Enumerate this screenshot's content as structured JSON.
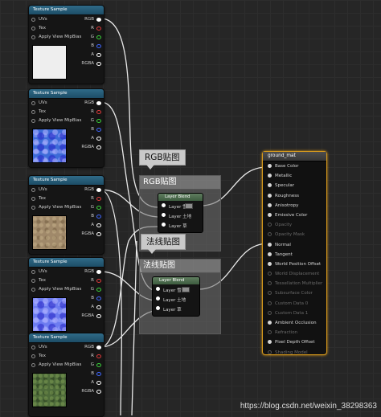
{
  "texture_nodes": [
    {
      "title": "Texture Sample",
      "thumb": "#eeeeee",
      "thumb_style": "white"
    },
    {
      "title": "Texture Sample",
      "thumb": "#3d6bd8",
      "thumb_style": "normal"
    },
    {
      "title": "Texture Sample",
      "thumb": "#a0896a",
      "thumb_style": "sand"
    },
    {
      "title": "Texture Sample",
      "thumb": "#6d7cf0",
      "thumb_style": "normal2"
    },
    {
      "title": "Texture Sample",
      "thumb": "#4e6b3a",
      "thumb_style": "grass"
    }
  ],
  "texture_pins_in": [
    "UVs",
    "Tex",
    "Apply View MipBias"
  ],
  "texture_pins_out": [
    "RGB",
    "R",
    "G",
    "B",
    "A",
    "RGBA"
  ],
  "pin_colors": {
    "rgb": "#ffffff",
    "r": "#e23b3b",
    "g": "#3bd33b",
    "b": "#3f67ff",
    "a": "#ffffff",
    "rgba": "#ffffff"
  },
  "comments": [
    {
      "bubble": "RGB贴图",
      "title": "RGB贴图"
    },
    {
      "bubble": "法线贴图",
      "title": "法线贴图"
    }
  ],
  "blend_nodes": [
    {
      "title": "Layer Blend",
      "rows": [
        "Layer 雪",
        "Layer 土地",
        "Layer 草"
      ]
    },
    {
      "title": "Layer Blend",
      "rows": [
        "Layer 雪",
        "Layer 土地",
        "Layer 草"
      ]
    }
  ],
  "material": {
    "title": "ground_mat",
    "inputs": [
      {
        "label": "Base Color",
        "enabled": true
      },
      {
        "label": "Metallic",
        "enabled": true
      },
      {
        "label": "Specular",
        "enabled": true
      },
      {
        "label": "Roughness",
        "enabled": true
      },
      {
        "label": "Anisotropy",
        "enabled": true
      },
      {
        "label": "Emissive Color",
        "enabled": true
      },
      {
        "label": "Opacity",
        "enabled": false
      },
      {
        "label": "Opacity Mask",
        "enabled": false
      },
      {
        "label": "Normal",
        "enabled": true
      },
      {
        "label": "Tangent",
        "enabled": true
      },
      {
        "label": "World Position Offset",
        "enabled": true
      },
      {
        "label": "World Displacement",
        "enabled": false
      },
      {
        "label": "Tessellation Multiplier",
        "enabled": false
      },
      {
        "label": "Subsurface Color",
        "enabled": false
      },
      {
        "label": "Custom Data 0",
        "enabled": false
      },
      {
        "label": "Custom Data 1",
        "enabled": false
      },
      {
        "label": "Ambient Occlusion",
        "enabled": true
      },
      {
        "label": "Refraction",
        "enabled": false
      },
      {
        "label": "Pixel Depth Offset",
        "enabled": true
      },
      {
        "label": "Shading Model",
        "enabled": false
      }
    ]
  },
  "watermark": "https://blog.csdn.net/weixin_38298363"
}
